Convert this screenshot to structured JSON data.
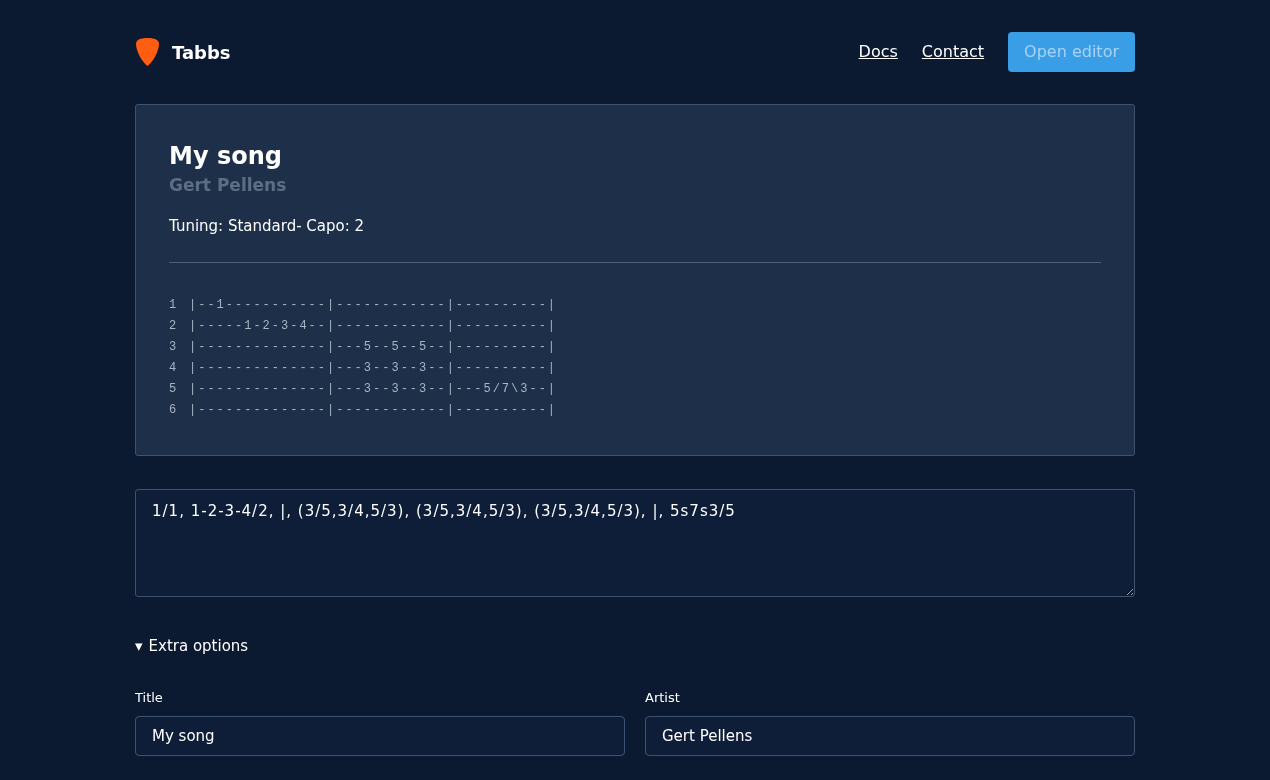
{
  "header": {
    "logo_text": "Tabbs",
    "nav": [
      "Docs",
      "Contact"
    ],
    "button": "Open editor"
  },
  "song": {
    "title": "My song",
    "artist": "Gert Pellens",
    "meta": "Tuning: Standard- Capo: 2",
    "tab_lines": [
      {
        "number": "1",
        "text": "|--1-----------|------------|----------|"
      },
      {
        "number": "2",
        "text": "|-----1-2-3-4--|------------|----------|"
      },
      {
        "number": "3",
        "text": "|--------------|---5--5--5--|----------|"
      },
      {
        "number": "4",
        "text": "|--------------|---3--3--3--|----------|"
      },
      {
        "number": "5",
        "text": "|--------------|---3--3--3--|---5/7\\3--|"
      },
      {
        "number": "6",
        "text": "|--------------|------------|----------|"
      }
    ]
  },
  "input": {
    "value": "1/1, 1-2-3-4/2, |, (3/5,3/4,5/3), (3/5,3/4,5/3), (3/5,3/4,5/3), |, 5s7s3/5"
  },
  "extra_options": {
    "marker": "▾",
    "label": "Extra options",
    "expanded": true,
    "fields": [
      {
        "label": "Title",
        "value": "My song"
      },
      {
        "label": "Artist",
        "value": "Gert Pellens"
      }
    ]
  }
}
